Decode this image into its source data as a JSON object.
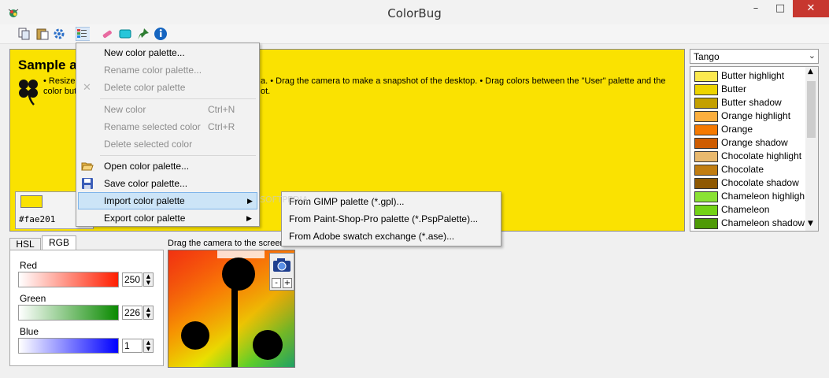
{
  "window": {
    "title": "ColorBug",
    "minimize": "–",
    "maximize": "□",
    "close": "✕"
  },
  "sample": {
    "title": "Sample a",
    "lines": [
      "• Resize",
      "a. • Drag the camera to make a snapshot of the desktop. • Drag colors between the \"User\" palette and the",
      "color butt",
      "ot."
    ],
    "hex": "#fae201"
  },
  "palette": {
    "selected": "Tango",
    "items": [
      {
        "label": "Butter highlight",
        "color": "#fce94f"
      },
      {
        "label": "Butter",
        "color": "#edd400"
      },
      {
        "label": "Butter shadow",
        "color": "#c4a000"
      },
      {
        "label": "Orange highlight",
        "color": "#fcaf3e"
      },
      {
        "label": "Orange",
        "color": "#f57900"
      },
      {
        "label": "Orange shadow",
        "color": "#ce5c00"
      },
      {
        "label": "Chocolate highlight",
        "color": "#e9b96e"
      },
      {
        "label": "Chocolate",
        "color": "#c17d11"
      },
      {
        "label": "Chocolate shadow",
        "color": "#8f5902"
      },
      {
        "label": "Chameleon highligh",
        "color": "#8ae234"
      },
      {
        "label": "Chameleon",
        "color": "#73d216"
      },
      {
        "label": "Chameleon shadow",
        "color": "#4e9a06"
      }
    ]
  },
  "tabs": {
    "hsl": "HSL",
    "rgb": "RGB"
  },
  "rgb": {
    "red_label": "Red",
    "red_value": "250",
    "green_label": "Green",
    "green_value": "226",
    "blue_label": "Blue",
    "blue_value": "1"
  },
  "camera": {
    "label": "Drag the camera to the screen",
    "zoom_out": "-",
    "zoom_in": "+"
  },
  "menu": {
    "new_palette": "New color palette...",
    "rename_palette": "Rename color palette...",
    "delete_palette": "Delete color palette",
    "new_color": "New color",
    "new_color_shortcut": "Ctrl+N",
    "rename_color": "Rename selected color",
    "rename_color_shortcut": "Ctrl+R",
    "delete_color": "Delete selected color",
    "open_palette": "Open color palette...",
    "save_palette": "Save color palette...",
    "import_palette": "Import color palette",
    "export_palette": "Export color palette",
    "arrow": "▶"
  },
  "submenu": {
    "gimp": "From GIMP palette (*.gpl)...",
    "psp": "From Paint-Shop-Pro palette (*.PspPalette)...",
    "ase": "From Adobe swatch exchange (*.ase)..."
  },
  "watermark": "SOFTPEDIA"
}
